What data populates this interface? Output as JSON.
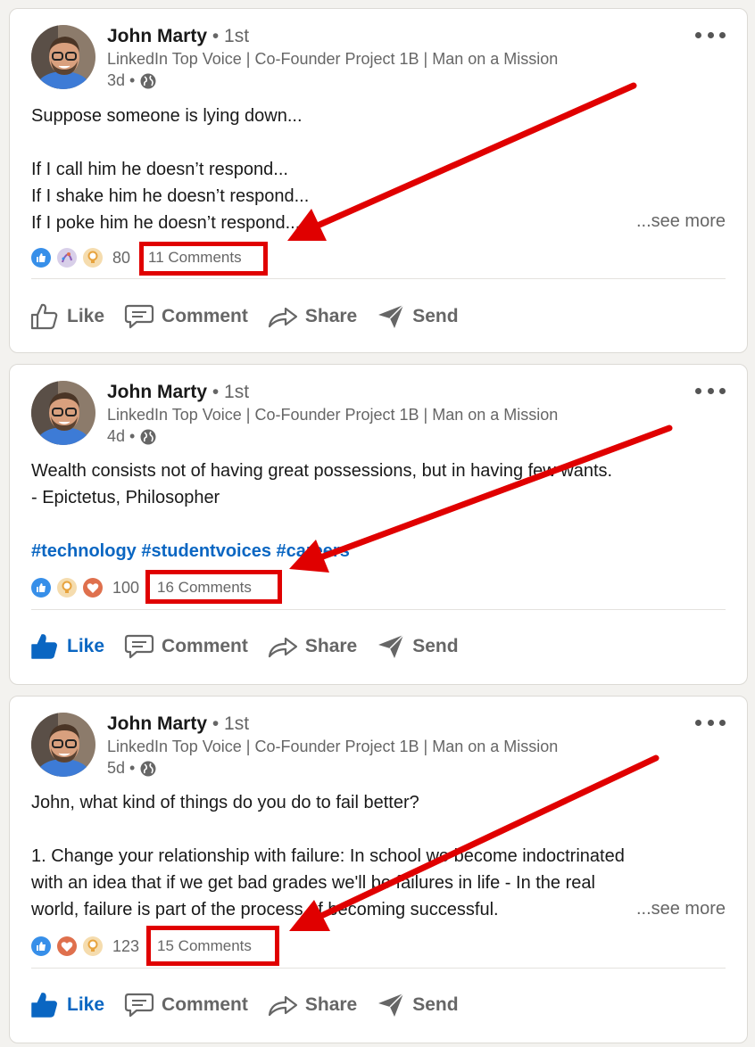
{
  "posts": [
    {
      "author": "John Marty",
      "degree": "• 1st",
      "headline": "LinkedIn Top Voice | Co-Founder Project 1B | Man on a Mission",
      "time": "3d •",
      "lines": [
        "Suppose someone is lying down...",
        "",
        "If I call him he doesn’t respond...",
        "If I shake him he doesn’t respond...",
        "If I poke him he doesn’t respond..."
      ],
      "see_more": "...see more",
      "reactions": [
        "like",
        "celebrate",
        "insightful"
      ],
      "reaction_count": "80",
      "comments": "11 Comments",
      "liked": false
    },
    {
      "author": "John Marty",
      "degree": "• 1st",
      "headline": "LinkedIn Top Voice | Co-Founder Project 1B | Man on a Mission",
      "time": "4d •",
      "lines": [
        "Wealth consists not of having great possessions, but in having few wants.",
        "- Epictetus, Philosopher"
      ],
      "hashtags": "#technology #studentvoices #careers",
      "reactions": [
        "like",
        "insightful",
        "love"
      ],
      "reaction_count": "100",
      "comments": "16 Comments",
      "liked": true
    },
    {
      "author": "John Marty",
      "degree": "• 1st",
      "headline": "LinkedIn Top Voice | Co-Founder Project 1B | Man on a Mission",
      "time": "5d •",
      "lines": [
        "John, what kind of things do you do to fail better?",
        "",
        "1. Change your relationship with failure: In school we become indoctrinated",
        "with an idea that if we get bad grades we'll be failures in life - In the real",
        "world, failure is part of the process of becoming successful."
      ],
      "see_more": "...see more",
      "reactions": [
        "like",
        "love",
        "insightful"
      ],
      "reaction_count": "123",
      "comments": "15 Comments",
      "liked": true
    }
  ],
  "actions": {
    "like": "Like",
    "comment": "Comment",
    "share": "Share",
    "send": "Send"
  },
  "colors": {
    "annotation_red": "#e00000",
    "linkedin_blue": "#0a66c2",
    "love_red": "#df704d",
    "insightful_gold": "#e7a33e"
  }
}
